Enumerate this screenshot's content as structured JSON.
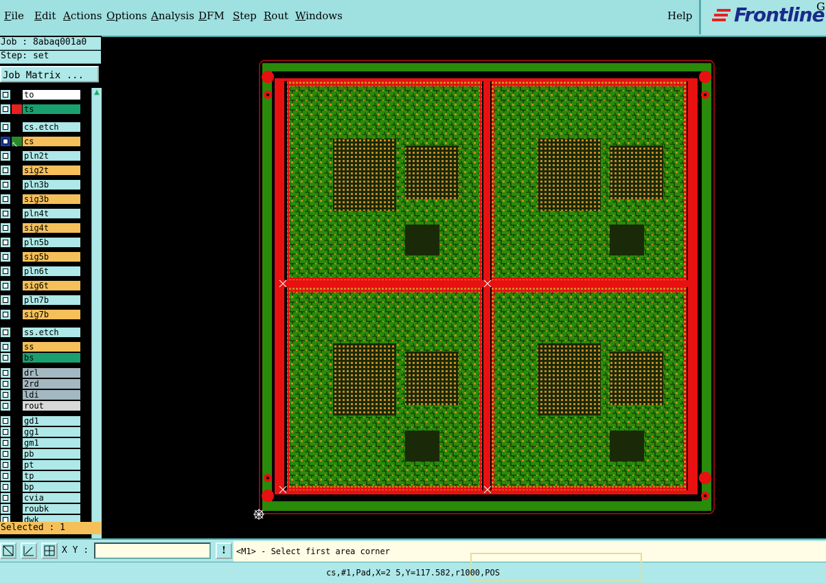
{
  "menu": {
    "items": [
      {
        "label": "File",
        "ul": "F",
        "rest": "ile"
      },
      {
        "label": "Edit",
        "ul": "E",
        "rest": "dit"
      },
      {
        "label": "Actions",
        "ul": "A",
        "rest": "ctions"
      },
      {
        "label": "Options",
        "ul": "O",
        "rest": "ptions"
      },
      {
        "label": "Analysis",
        "ul": "A",
        "rest": "nalysis"
      },
      {
        "label": "DFM",
        "ul": "D",
        "rest": "FM"
      },
      {
        "label": "Step",
        "ul": "S",
        "rest": "tep"
      },
      {
        "label": "Rout",
        "ul": "R",
        "rest": "out"
      },
      {
        "label": "Windows",
        "ul": "W",
        "rest": "indows"
      }
    ],
    "help": "Help"
  },
  "logo": {
    "text": "Frontline",
    "suffix": "G"
  },
  "job_label": "Job : 8abaq001a0",
  "step_label": "Step: set",
  "job_matrix_button": "Job Matrix ...",
  "layers": [
    {
      "name": "to",
      "color": "#ffffff",
      "swatch": "#000000"
    },
    {
      "name": "ts",
      "color": "#1aa070",
      "swatch": "#e82020"
    },
    {
      "name": "cs.etch",
      "color": "#aee8e8",
      "swatch": "#000000"
    },
    {
      "name": "cs",
      "color": "#f5c05a",
      "swatch": "#2a8a2a",
      "active": true
    },
    {
      "name": "pln2t",
      "color": "#aee8e8",
      "swatch": "#000000"
    },
    {
      "name": "sig2t",
      "color": "#f5c05a",
      "swatch": "#000000"
    },
    {
      "name": "pln3b",
      "color": "#aee8e8",
      "swatch": "#000000"
    },
    {
      "name": "sig3b",
      "color": "#f5c05a",
      "swatch": "#000000"
    },
    {
      "name": "pln4t",
      "color": "#aee8e8",
      "swatch": "#000000"
    },
    {
      "name": "sig4t",
      "color": "#f5c05a",
      "swatch": "#000000"
    },
    {
      "name": "pln5b",
      "color": "#aee8e8",
      "swatch": "#000000"
    },
    {
      "name": "sig5b",
      "color": "#f5c05a",
      "swatch": "#000000"
    },
    {
      "name": "pln6t",
      "color": "#aee8e8",
      "swatch": "#000000"
    },
    {
      "name": "sig6t",
      "color": "#f5c05a",
      "swatch": "#000000"
    },
    {
      "name": "pln7b",
      "color": "#aee8e8",
      "swatch": "#000000"
    },
    {
      "name": "sig7b",
      "color": "#f5c05a",
      "swatch": "#000000"
    },
    {
      "name": "ss.etch",
      "color": "#aee8e8",
      "swatch": "#000000"
    },
    {
      "name": "ss",
      "color": "#f5c05a",
      "swatch": "#000000"
    },
    {
      "name": "bs",
      "color": "#1aa070",
      "swatch": "#000000"
    },
    {
      "name": "drl",
      "color": "#a3b8c0",
      "swatch": "#000000"
    },
    {
      "name": "2rd",
      "color": "#a3b8c0",
      "swatch": "#000000"
    },
    {
      "name": "ldi",
      "color": "#a3b8c0",
      "swatch": "#000000"
    },
    {
      "name": "rout",
      "color": "#d8d8d8",
      "swatch": "#000000"
    },
    {
      "name": "gd1",
      "color": "#aee8e8",
      "swatch": "#000000"
    },
    {
      "name": "gg1",
      "color": "#aee8e8",
      "swatch": "#000000"
    },
    {
      "name": "gm1",
      "color": "#aee8e8",
      "swatch": "#000000"
    },
    {
      "name": "pb",
      "color": "#aee8e8",
      "swatch": "#000000"
    },
    {
      "name": "pt",
      "color": "#aee8e8",
      "swatch": "#000000"
    },
    {
      "name": "tp",
      "color": "#aee8e8",
      "swatch": "#000000"
    },
    {
      "name": "bp",
      "color": "#aee8e8",
      "swatch": "#000000"
    },
    {
      "name": "cvia",
      "color": "#aee8e8",
      "swatch": "#000000"
    },
    {
      "name": "roubk",
      "color": "#aee8e8",
      "swatch": "#000000"
    },
    {
      "name": "dwk",
      "color": "#aee8e8",
      "swatch": "#000000"
    }
  ],
  "selected_label": "Selected : 1",
  "command": {
    "xy_label": "X Y :",
    "xy_value": "",
    "message": "<M1> - Select first area corner",
    "alert_icon": "!"
  },
  "status": "cs,#1,Pad,X=2 5,Y=117.582,r1000,POS",
  "colors": {
    "board_green": "#2a8a0a",
    "pad_orange": "#c88a20",
    "copper_red": "#e81010",
    "panel_bg": "#aee8e8",
    "menubar_bg": "#9fe0e0"
  }
}
